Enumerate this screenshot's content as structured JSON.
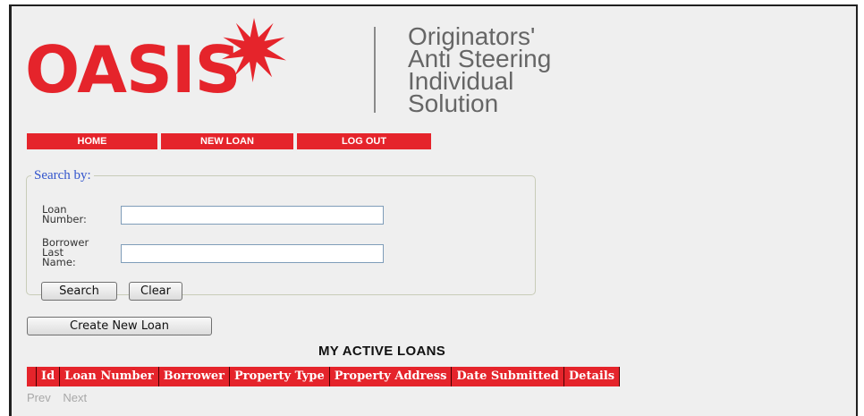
{
  "brand": {
    "logo_text": "OASIS",
    "tagline": [
      "Originators'",
      "Anti Steering",
      "Individual",
      "Solution"
    ],
    "colors": {
      "brand_red": "#e5242b",
      "tagline_gray": "#666666"
    }
  },
  "nav": {
    "items": [
      "HOME",
      "NEW LOAN",
      "LOG OUT"
    ]
  },
  "search": {
    "legend": "Search by:",
    "loan_number_label": "Loan Number:",
    "loan_number_value": "",
    "borrower_label": "Borrower Last Name:",
    "borrower_value": "",
    "search_button": "Search",
    "clear_button": "Clear"
  },
  "create_button": "Create New Loan",
  "loans": {
    "title": "MY ACTIVE LOANS",
    "columns": [
      "Id",
      "Loan Number",
      "Borrower",
      "Property Type",
      "Property Address",
      "Date Submitted",
      "Details"
    ],
    "rows": []
  },
  "pager": {
    "prev": "Prev",
    "next": "Next"
  }
}
